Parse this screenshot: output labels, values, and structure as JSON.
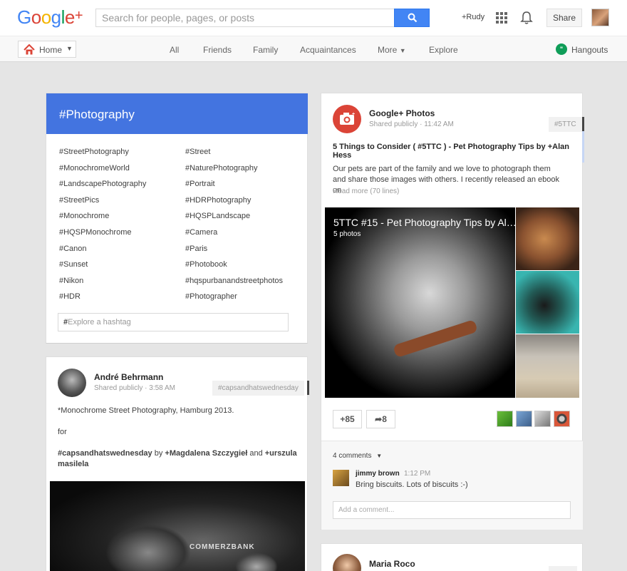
{
  "header": {
    "logo": {
      "g": "G",
      "o1": "o",
      "o2": "o",
      "g2": "g",
      "l": "l",
      "e": "e",
      "plus": "+"
    },
    "search_placeholder": "Search for people, pages, or posts",
    "user_link": "+Rudy",
    "share_label": "Share"
  },
  "nav": {
    "home_label": "Home",
    "items": [
      "All",
      "Friends",
      "Family",
      "Acquaintances",
      "More",
      "Explore"
    ],
    "hangouts_label": "Hangouts"
  },
  "hashtags": {
    "title": "#Photography",
    "left": [
      "#StreetPhotography",
      "#MonochromeWorld",
      "#LandscapePhotography",
      "#StreetPics",
      "#Monochrome",
      "#HQSPMonochrome",
      "#Canon",
      "#Sunset",
      "#Nikon",
      "#HDR"
    ],
    "right": [
      "#Street",
      "#NaturePhotography",
      "#Portrait",
      "#HDRPhotography",
      "#HQSPLandscape",
      "#Camera",
      "#Paris",
      "#Photobook",
      "#hqspurbanandstreetphotos",
      "#Photographer"
    ],
    "explore_hash": "#",
    "explore_placeholder": "Explore a hashtag"
  },
  "post_andre": {
    "author": "André Behrmann",
    "meta": "Shared publicly  ·  3:58 AM",
    "tag": "#capsandhatswednesday",
    "line1": "*Monochrome Street Photography, Hamburg 2013.",
    "line2": "for",
    "line3_tag": "#capsandhatswednesday",
    "line3_by": " by ",
    "line3_mention1": "+Magdalena Szczygieł",
    "line3_and": " and ",
    "line3_mention2": "+urszula",
    "line4_mention2": "masilela",
    "photo_sign": "COMMERZBANK"
  },
  "post_photos": {
    "author": "Google+ Photos",
    "meta": "Shared publicly  ·  11:42 AM",
    "tag": "#5TTC",
    "title": "5 Things to Consider ( #5TTC ) - Pet Photography Tips by +Alan Hess",
    "body": "Our pets are part of the family and we love to photograph them and share those images with others. I recently released an ebook on",
    "read_more": "Read more (70 lines)",
    "album_title": "5TTC #15 - Pet Photography Tips by Al…",
    "album_count": "5 photos",
    "plus_count": "+85",
    "share_count": "8",
    "comments_count": "4 comments",
    "comment": {
      "author": "jimmy brown",
      "time": "1:12 PM",
      "text": "Bring biscuits. Lots of biscuits :-)"
    },
    "add_comment_placeholder": "Add a comment..."
  },
  "post_maria": {
    "author": "Maria Roco"
  },
  "colors": {
    "accent": "#4374e0",
    "google_red": "#db4437",
    "search_blue": "#4285f4",
    "hangouts_green": "#0f9d58"
  }
}
